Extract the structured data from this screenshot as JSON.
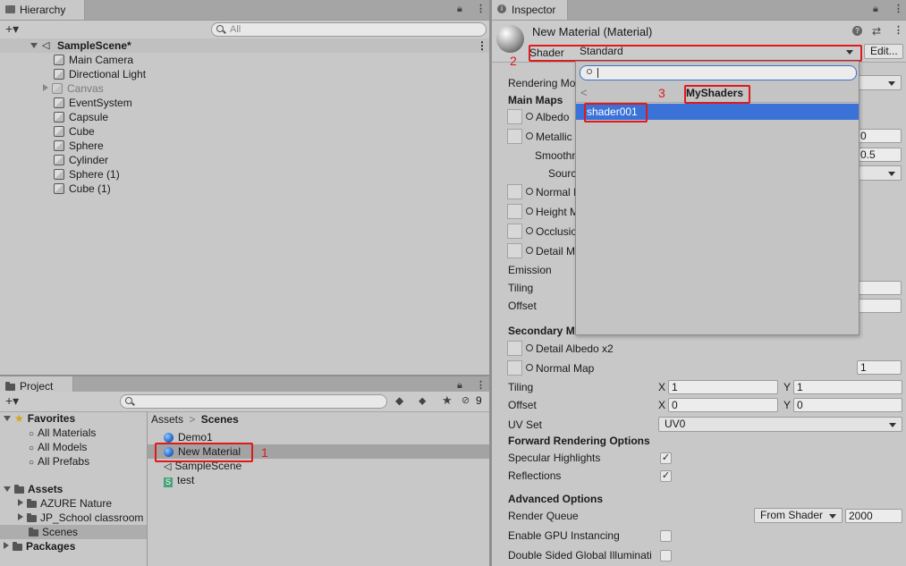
{
  "hierarchy": {
    "tab_title": "Hierarchy",
    "add_label": "+▾",
    "search_placeholder": "All",
    "scene_name": "SampleScene*",
    "items": [
      {
        "label": "Main Camera"
      },
      {
        "label": "Directional Light"
      },
      {
        "label": "Canvas"
      },
      {
        "label": "EventSystem"
      },
      {
        "label": "Capsule"
      },
      {
        "label": "Cube"
      },
      {
        "label": "Sphere"
      },
      {
        "label": "Cylinder"
      },
      {
        "label": "Sphere (1)"
      },
      {
        "label": "Cube (1)"
      }
    ]
  },
  "project": {
    "tab_title": "Project",
    "add_label": "+▾",
    "hidden_count": "9",
    "favorites_label": "Favorites",
    "favorites": [
      "All Materials",
      "All Models",
      "All Prefabs"
    ],
    "assets_label": "Assets",
    "asset_folders": [
      "AZURE Nature",
      "JP_School classroom",
      "Scenes"
    ],
    "packages_label": "Packages",
    "breadcrumb_root": "Assets",
    "breadcrumb_sep": ">",
    "breadcrumb_current": "Scenes",
    "files": [
      {
        "label": "Demo1",
        "type": "material"
      },
      {
        "label": "New Material",
        "type": "material"
      },
      {
        "label": "SampleScene",
        "type": "scene"
      },
      {
        "label": "test",
        "type": "script"
      }
    ],
    "annotation": "1"
  },
  "inspector": {
    "tab_title": "Inspector",
    "title": "New Material (Material)",
    "shader_label": "Shader",
    "shader_value": "Standard",
    "edit_label": "Edit...",
    "annotation_shader": "2",
    "annotation_group": "3",
    "rendering_mode_label": "Rendering Mo",
    "main_maps_label": "Main Maps",
    "albedo_label": "Albedo",
    "metallic_label": "Metallic",
    "metallic_value": "0",
    "smoothness_label": "Smoothn",
    "smoothness_value": "0.5",
    "source_label": "Sourc",
    "normal_label": "Normal I",
    "height_label": "Height M",
    "occlusion_label": "Occlusio",
    "detail_mask_label": "Detail M",
    "emission_label": "Emission",
    "tiling_label": "Tiling",
    "offset_label": "Offset",
    "secondary_maps_label": "Secondary M",
    "detail_albedo_label": "Detail Albedo x2",
    "normal_map_label": "Normal Map",
    "normal_map_value": "1",
    "tiling2_label": "Tiling",
    "tiling_x": "1",
    "tiling_y": "1",
    "offset2_label": "Offset",
    "offset_x": "0",
    "offset_y": "0",
    "x_label": "X",
    "y_label": "Y",
    "uv_set_label": "UV Set",
    "uv_set_value": "UV0",
    "forward_label": "Forward Rendering Options",
    "specular_label": "Specular Highlights",
    "reflections_label": "Reflections",
    "advanced_label": "Advanced Options",
    "render_queue_label": "Render Queue",
    "render_queue_mode": "From Shader",
    "render_queue_value": "2000",
    "gpu_instancing_label": "Enable GPU Instancing",
    "double_sided_label": "Double Sided Global Illuminati"
  },
  "shader_popup": {
    "search_value": "",
    "back_glyph": "<",
    "group_title": "MyShaders",
    "items": [
      "shader001"
    ]
  },
  "colors": {
    "selection_blue": "#3a72d8",
    "annotation_red": "#e0191b"
  }
}
